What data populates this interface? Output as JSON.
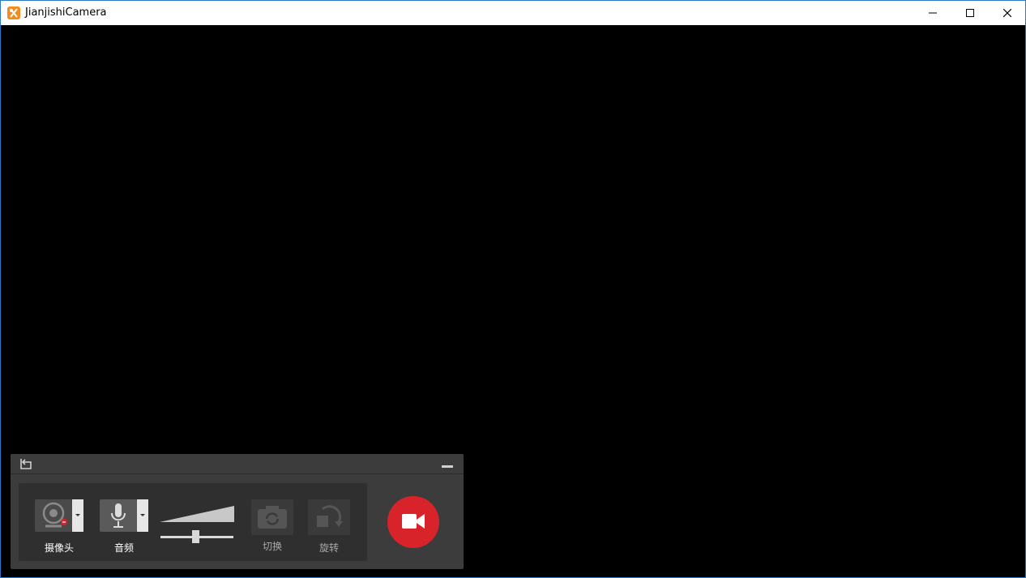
{
  "window": {
    "title": "JianjishiCamera",
    "accent_color": "#2b78c5",
    "controls": {
      "minimize_icon": "minimize-icon",
      "maximize_icon": "maximize-icon",
      "close_icon": "close-icon"
    }
  },
  "panel": {
    "header": {
      "back_icon": "back-icon",
      "collapse_icon": "collapse-icon"
    },
    "camera": {
      "label": "摄像头",
      "icon": "webcam-icon"
    },
    "audio": {
      "label": "音频",
      "icon": "microphone-icon"
    },
    "volume": {
      "level_percent": 50
    },
    "switch": {
      "label": "切换",
      "icon": "switch-camera-icon"
    },
    "rotate": {
      "label": "旋转",
      "icon": "rotate-icon"
    },
    "record": {
      "icon": "video-camera-icon",
      "color": "#d8232a"
    }
  }
}
